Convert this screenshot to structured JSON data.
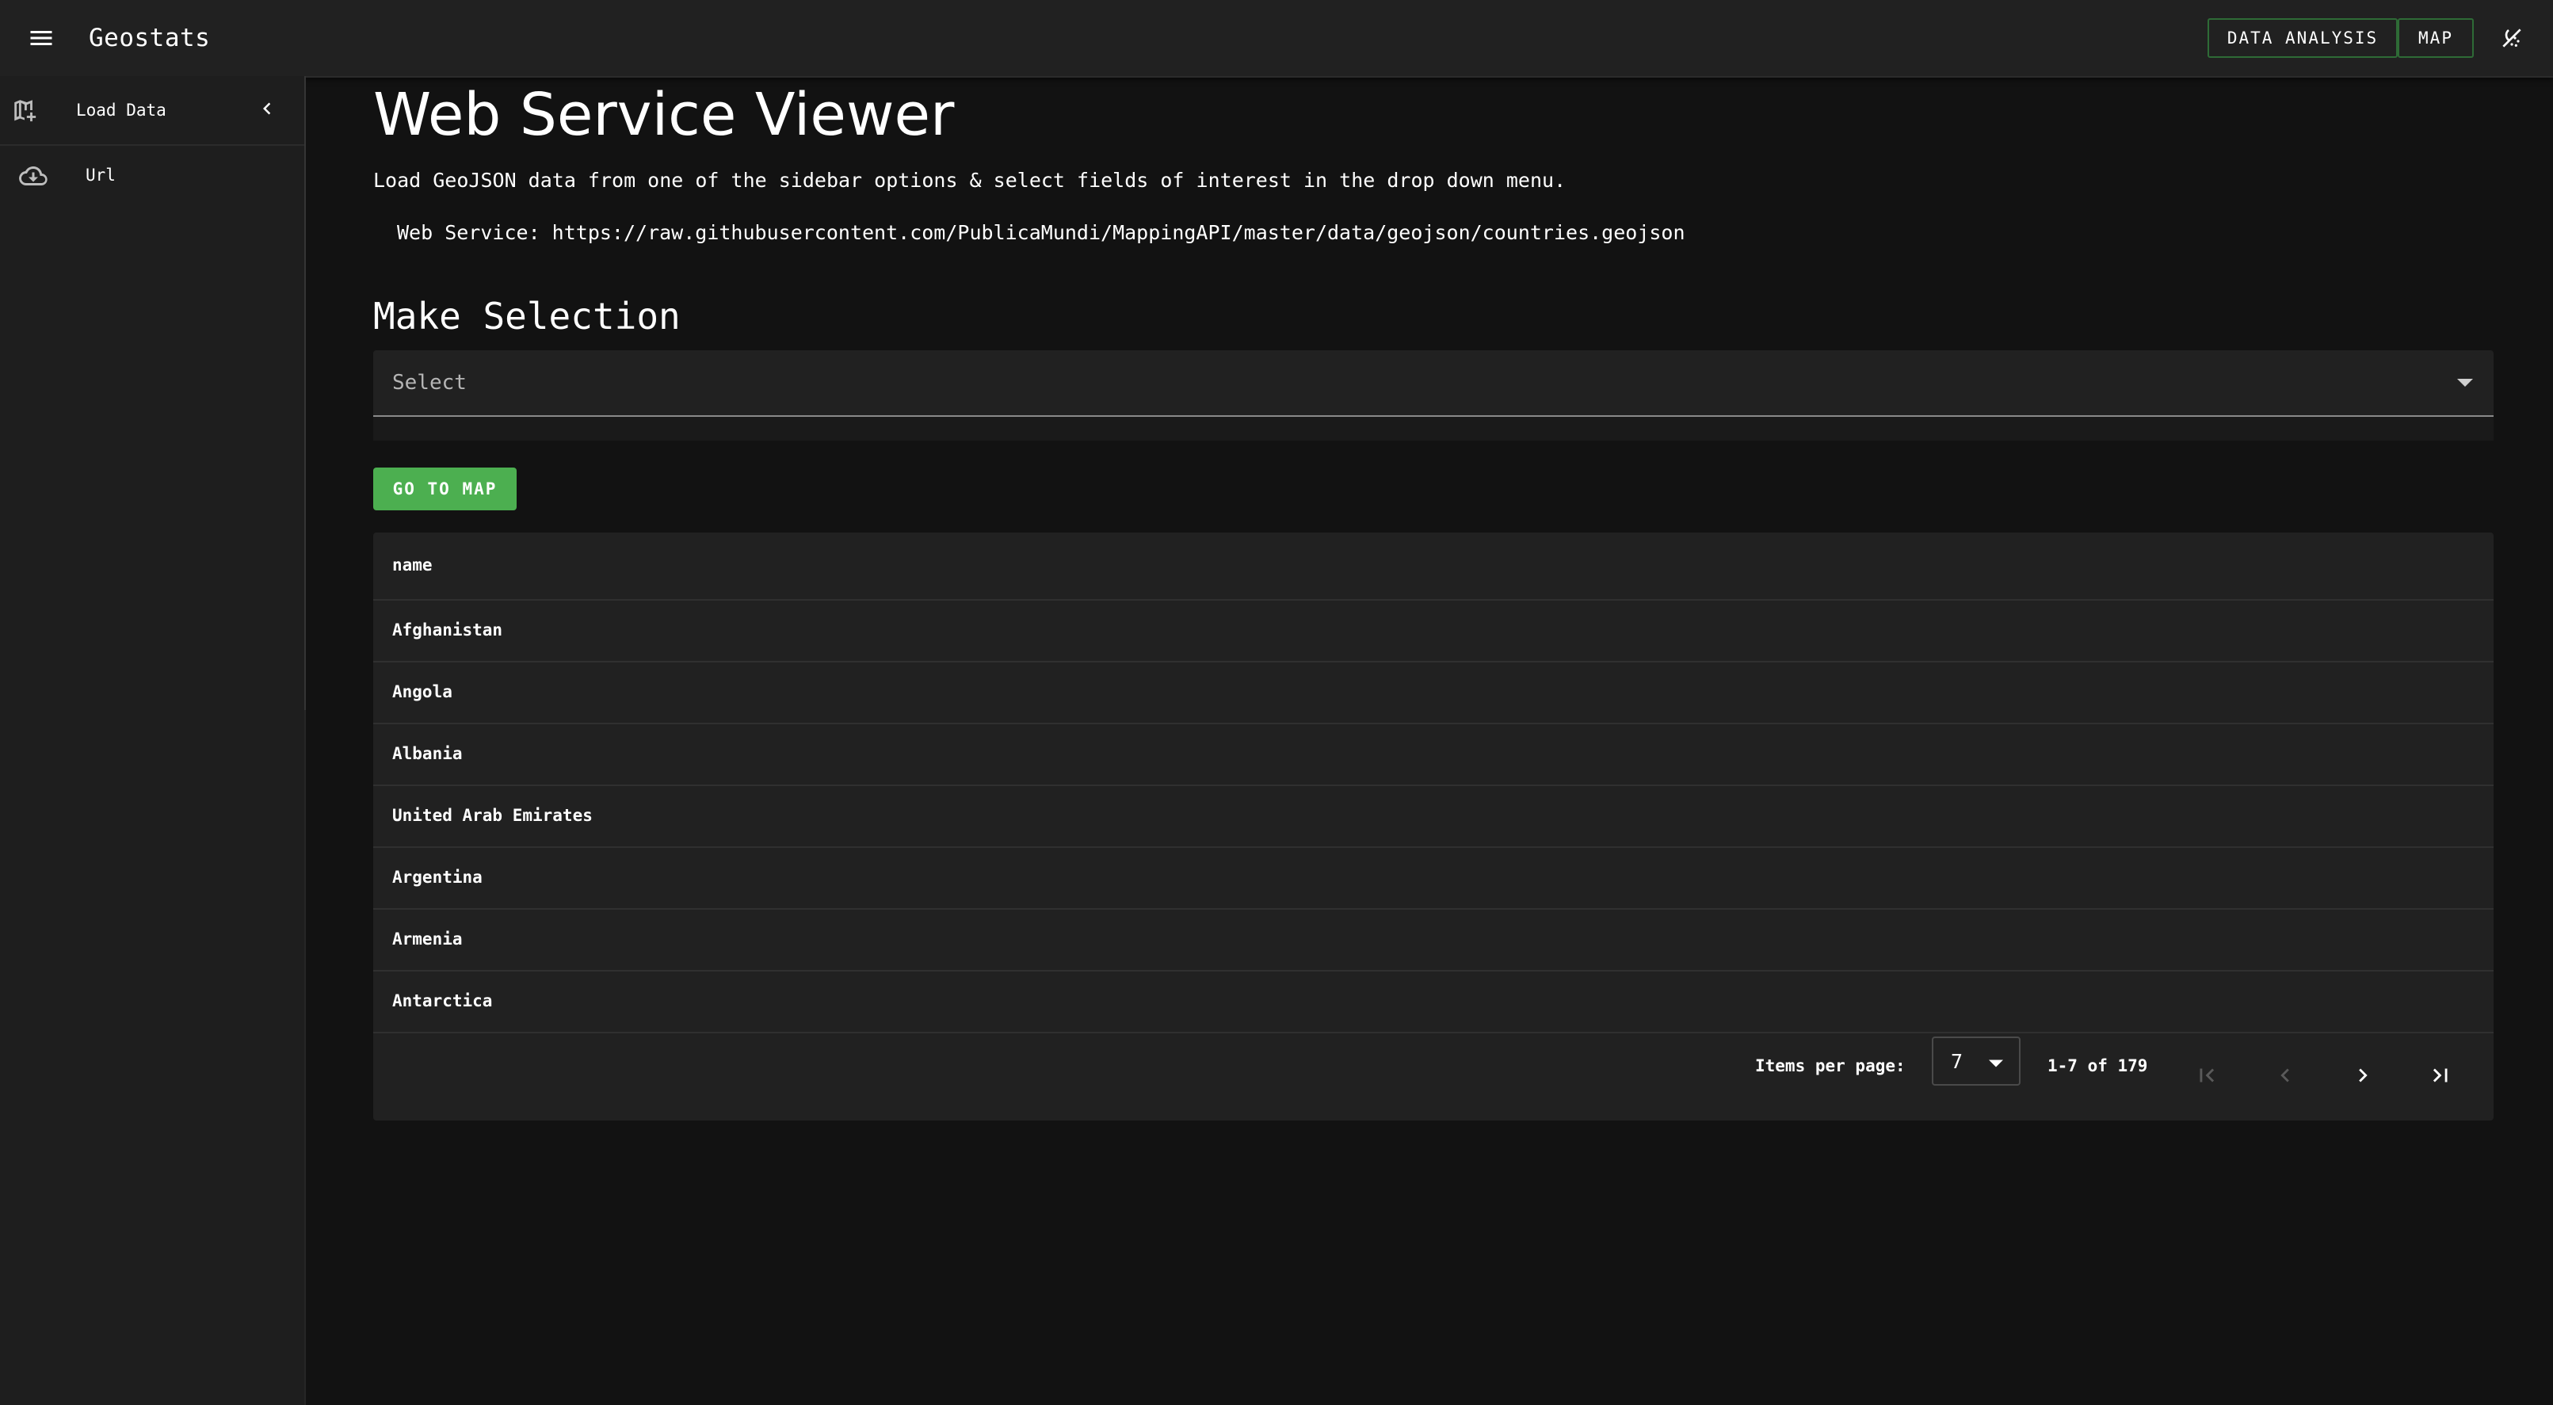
{
  "header": {
    "app_title": "Geostats",
    "nav_buttons": [
      "DATA ANALYSIS",
      "MAP"
    ],
    "icons": [
      "menu-icon",
      "theme-toggle-icon"
    ]
  },
  "sidebar": {
    "load_data_label": "Load Data",
    "items": [
      {
        "label": "Url",
        "icon": "cloud-download-icon"
      }
    ]
  },
  "main": {
    "title": "Web Service Viewer",
    "intro": "Load GeoJSON data from one of the sidebar options & select fields of interest in the drop down menu.",
    "service_line": "Web Service: https://raw.githubusercontent.com/PublicaMundi/MappingAPI/master/data/geojson/countries.geojson",
    "section_title": "Make Selection",
    "select_placeholder": "Select",
    "go_button": "GO TO MAP"
  },
  "table": {
    "header": "name",
    "rows": [
      "Afghanistan",
      "Angola",
      "Albania",
      "United Arab Emirates",
      "Argentina",
      "Armenia",
      "Antarctica"
    ]
  },
  "pagination": {
    "items_per_page_label": "Items per page:",
    "items_per_page": "7",
    "range": "1-7 of 179"
  },
  "colors": {
    "background": "#121212",
    "surface": "#212121",
    "accent_green": "#4caf50",
    "outline_green": "#2e6b36"
  }
}
